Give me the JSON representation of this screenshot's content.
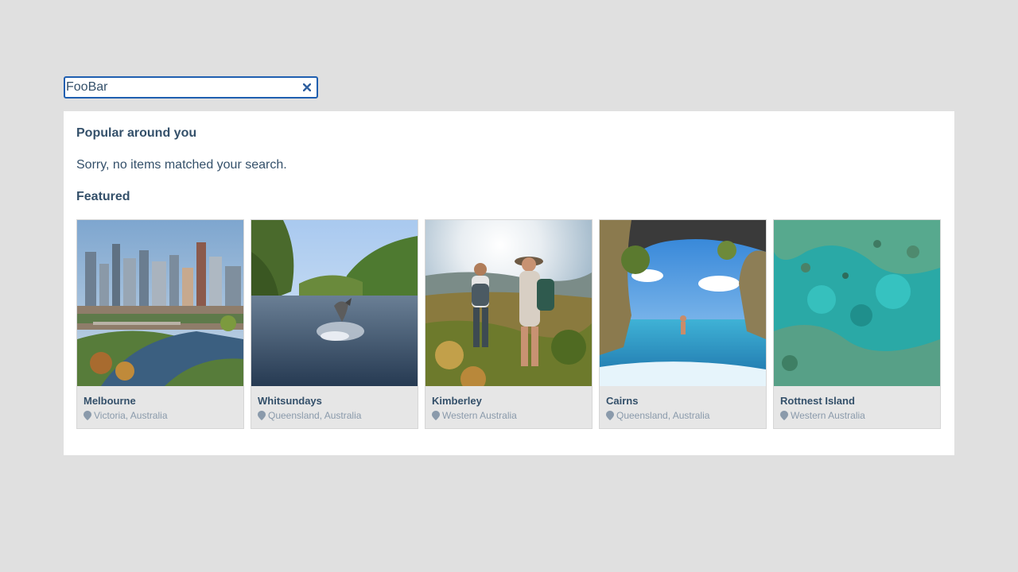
{
  "search": {
    "value": "FooBar",
    "clear_icon": "close-icon"
  },
  "results": {
    "popular_heading": "Popular around you",
    "empty_message": "Sorry, no items matched your search.",
    "featured_heading": "Featured"
  },
  "featured": [
    {
      "title": "Melbourne",
      "location": "Victoria, Australia",
      "icon": "pin-icon"
    },
    {
      "title": "Whitsundays",
      "location": "Queensland, Australia",
      "icon": "pin-icon"
    },
    {
      "title": "Kimberley",
      "location": "Western Australia",
      "icon": "pin-icon"
    },
    {
      "title": "Cairns",
      "location": "Queensland, Australia",
      "icon": "pin-icon"
    },
    {
      "title": "Rottnest Island",
      "location": "Western Australia",
      "icon": "pin-icon"
    }
  ],
  "colors": {
    "page_background": "#e0e0e0",
    "text": "#34506a",
    "muted_text": "#8a9aab",
    "accent": "#1f5fb0",
    "card_background": "#e6e6e6"
  }
}
